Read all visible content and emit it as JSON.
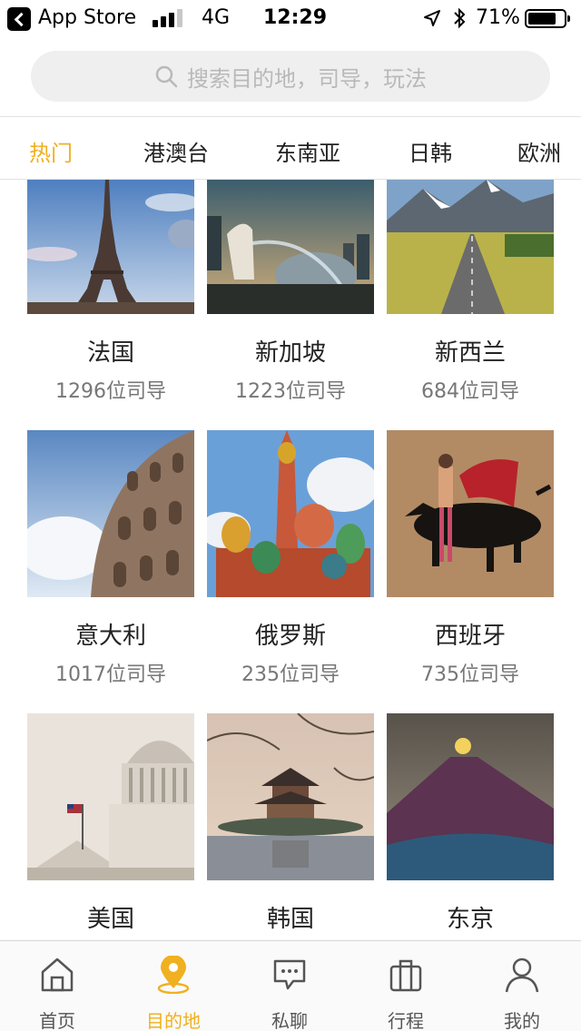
{
  "status_bar": {
    "back_app": "App Store",
    "network": "4G",
    "time": "12:29",
    "battery": "71%",
    "battery_level": 0.71,
    "signal_bars_active": 3
  },
  "search": {
    "placeholder": "搜索目的地，司导，玩法"
  },
  "tabs": [
    {
      "label": "热门",
      "active": true
    },
    {
      "label": "港澳台",
      "active": false
    },
    {
      "label": "东南亚",
      "active": false
    },
    {
      "label": "日韩",
      "active": false
    },
    {
      "label": "欧洲",
      "active": false
    }
  ],
  "destinations": [
    {
      "name": "法国",
      "count": "1296位司导",
      "image": "eiffel-tower-photo"
    },
    {
      "name": "新加坡",
      "count": "1223位司导",
      "image": "merlion-photo"
    },
    {
      "name": "新西兰",
      "count": "684位司导",
      "image": "mountain-road-photo"
    },
    {
      "name": "意大利",
      "count": "1017位司导",
      "image": "colosseum-photo"
    },
    {
      "name": "俄罗斯",
      "count": "235位司导",
      "image": "st-basils-cathedral-photo"
    },
    {
      "name": "西班牙",
      "count": "735位司导",
      "image": "bullfight-photo"
    },
    {
      "name": "美国",
      "count": "",
      "image": "capitol-dome-photo"
    },
    {
      "name": "韩国",
      "count": "",
      "image": "korean-pavilion-photo"
    },
    {
      "name": "东京",
      "count": "",
      "image": "mount-fuji-moon-photo"
    }
  ],
  "bottom_nav": [
    {
      "label": "首页",
      "icon": "home-icon",
      "active": false
    },
    {
      "label": "目的地",
      "icon": "location-pin-icon",
      "active": true
    },
    {
      "label": "私聊",
      "icon": "chat-bubble-icon",
      "active": false
    },
    {
      "label": "行程",
      "icon": "luggage-icon",
      "active": false
    },
    {
      "label": "我的",
      "icon": "person-icon",
      "active": false
    }
  ],
  "colors": {
    "accent": "#f0b020",
    "text": "#222222",
    "subtext": "#777777",
    "search_bg": "#efefef"
  }
}
